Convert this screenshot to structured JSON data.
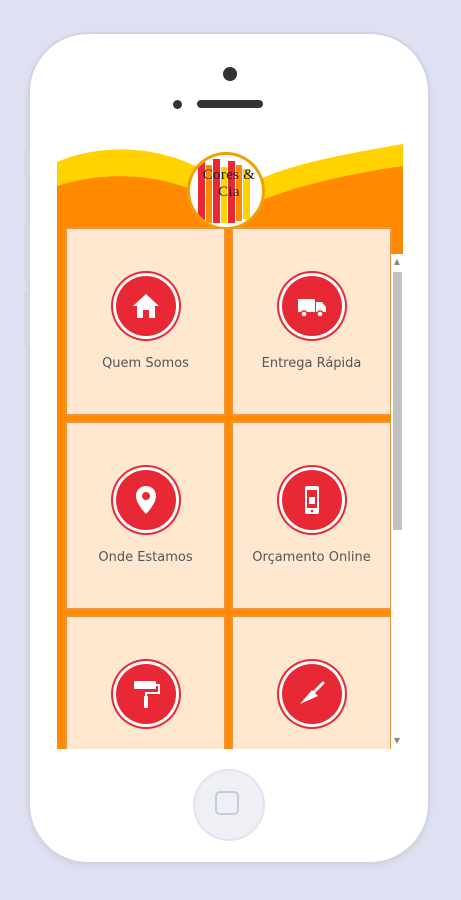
{
  "app": {
    "logo_text": "Cores & Cia",
    "colors": {
      "primary_orange": "#ff8a00",
      "accent_red": "#e82935",
      "tile_bg": "#ffe7d0",
      "header_yellow": "#ffd200"
    }
  },
  "menu": {
    "items": [
      {
        "label": "Quem Somos",
        "icon": "home-icon"
      },
      {
        "label": "Entrega Rápida",
        "icon": "truck-icon"
      },
      {
        "label": "Onde Estamos",
        "icon": "location-pin-icon"
      },
      {
        "label": "Orçamento Online",
        "icon": "smartphone-icon"
      },
      {
        "label": "",
        "icon": "paint-roller-icon"
      },
      {
        "label": "",
        "icon": "trowel-icon"
      }
    ]
  }
}
